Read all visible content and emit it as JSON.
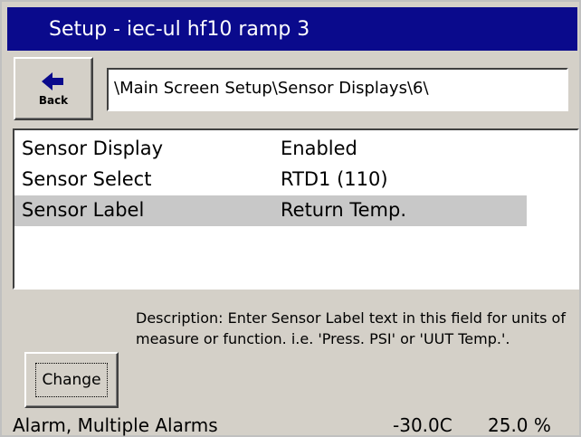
{
  "window": {
    "title": "Setup - iec-ul hf10 ramp 3"
  },
  "toolbar": {
    "back_label": "Back",
    "back_icon": "left-arrow-icon",
    "path": "\\Main Screen Setup\\Sensor Displays\\6\\"
  },
  "settings": {
    "rows": [
      {
        "name": "Sensor Display",
        "value": "Enabled",
        "selected": false
      },
      {
        "name": "Sensor Select",
        "value": "RTD1 (110)",
        "selected": false
      },
      {
        "name": "Sensor Label",
        "value": "Return Temp.",
        "selected": true
      }
    ]
  },
  "description": {
    "text": "Description:  Enter Sensor Label text in this field for units of measure or function. i.e. 'Press. PSI' or 'UUT Temp.'."
  },
  "actions": {
    "change_label": "Change"
  },
  "status": {
    "alarms": "Alarm, Multiple Alarms",
    "temperature": "-30.0C",
    "percent": "25.0 %"
  },
  "colors": {
    "titlebar": "#0a0a8c",
    "selected_row": "#c8c8c8",
    "background": "#d4d0c8"
  }
}
